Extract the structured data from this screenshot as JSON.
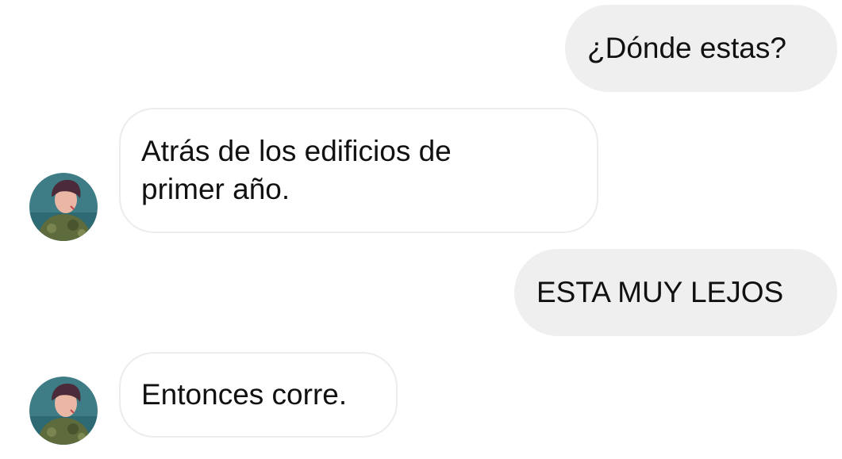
{
  "messages": [
    {
      "direction": "outgoing",
      "text": "¿Dónde estas?"
    },
    {
      "direction": "incoming",
      "text": "Atrás de los edificios de primer año."
    },
    {
      "direction": "outgoing",
      "text": "ESTA MUY LEJOS"
    },
    {
      "direction": "incoming",
      "text": "Entonces corre."
    }
  ],
  "colors": {
    "outgoing_bubble": "#efefef",
    "incoming_border": "#ececec",
    "text": "#111111",
    "background": "#ffffff"
  },
  "icons": {
    "avatar": "contact-avatar-photo"
  }
}
